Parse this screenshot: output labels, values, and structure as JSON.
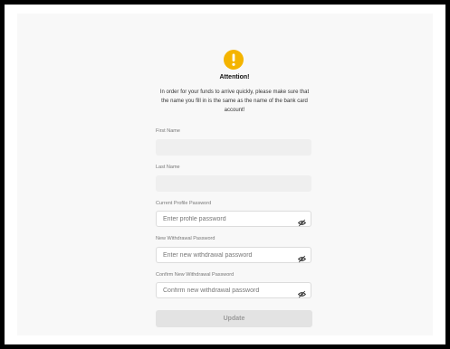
{
  "alert": {
    "icon": "exclamation-circle-icon",
    "icon_color": "#f4b400",
    "title": "Attention!",
    "message": "In order for your funds to arrive quickly, please make sure that the name you fill in is the same as the name of the bank card account!"
  },
  "form": {
    "first_name": {
      "label": "First Name",
      "value": ""
    },
    "last_name": {
      "label": "Last Name",
      "value": ""
    },
    "current_password": {
      "label": "Current Profile Password",
      "placeholder": "Enter profile password",
      "icon": "eye-off-icon"
    },
    "new_password": {
      "label": "New Withdrawal Password",
      "placeholder": "Enter new withdrawal password",
      "icon": "eye-off-icon"
    },
    "confirm_password": {
      "label": "Confirm New Withdrawal Password",
      "placeholder": "Confirm new withdrawal password",
      "icon": "eye-off-icon"
    },
    "submit_label": "Update"
  }
}
